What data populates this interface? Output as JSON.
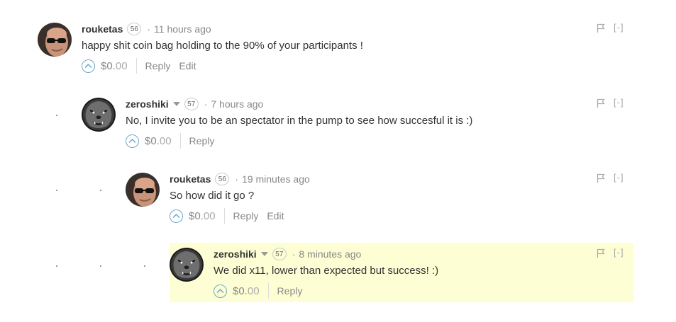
{
  "icons": {
    "flag": "flag-icon",
    "upvote": "chevron-up-icon",
    "caret": "caret-down-icon"
  },
  "colors": {
    "highlight_bg": "#fefed5",
    "upvote_ring": "#6ea9c8",
    "muted_text": "#888888"
  },
  "comments": [
    {
      "author": "rouketas",
      "reputation": "56",
      "separator": "·",
      "time": "11 hours ago",
      "body": "happy shit coin bag holding to the 90% of your participants !",
      "payout_main": "$0.",
      "payout_cents": "00",
      "reply_label": "Reply",
      "edit_label": "Edit",
      "collapse_label": "[-]"
    },
    {
      "author": "zeroshiki",
      "reputation": "57",
      "separator": "·",
      "time": "7 hours ago",
      "body": "No, I invite you to be an spectator in the pump to see how succesful it is :)",
      "payout_main": "$0.",
      "payout_cents": "00",
      "reply_label": "Reply",
      "collapse_label": "[-]"
    },
    {
      "author": "rouketas",
      "reputation": "56",
      "separator": "·",
      "time": "19 minutes ago",
      "body": "So how did it go ?",
      "payout_main": "$0.",
      "payout_cents": "00",
      "reply_label": "Reply",
      "edit_label": "Edit",
      "collapse_label": "[-]"
    },
    {
      "author": "zeroshiki",
      "reputation": "57",
      "separator": "·",
      "time": "8 minutes ago",
      "body": "We did x11, lower than expected but success! :)",
      "payout_main": "$0.",
      "payout_cents": "00",
      "reply_label": "Reply",
      "collapse_label": "[-]"
    }
  ]
}
